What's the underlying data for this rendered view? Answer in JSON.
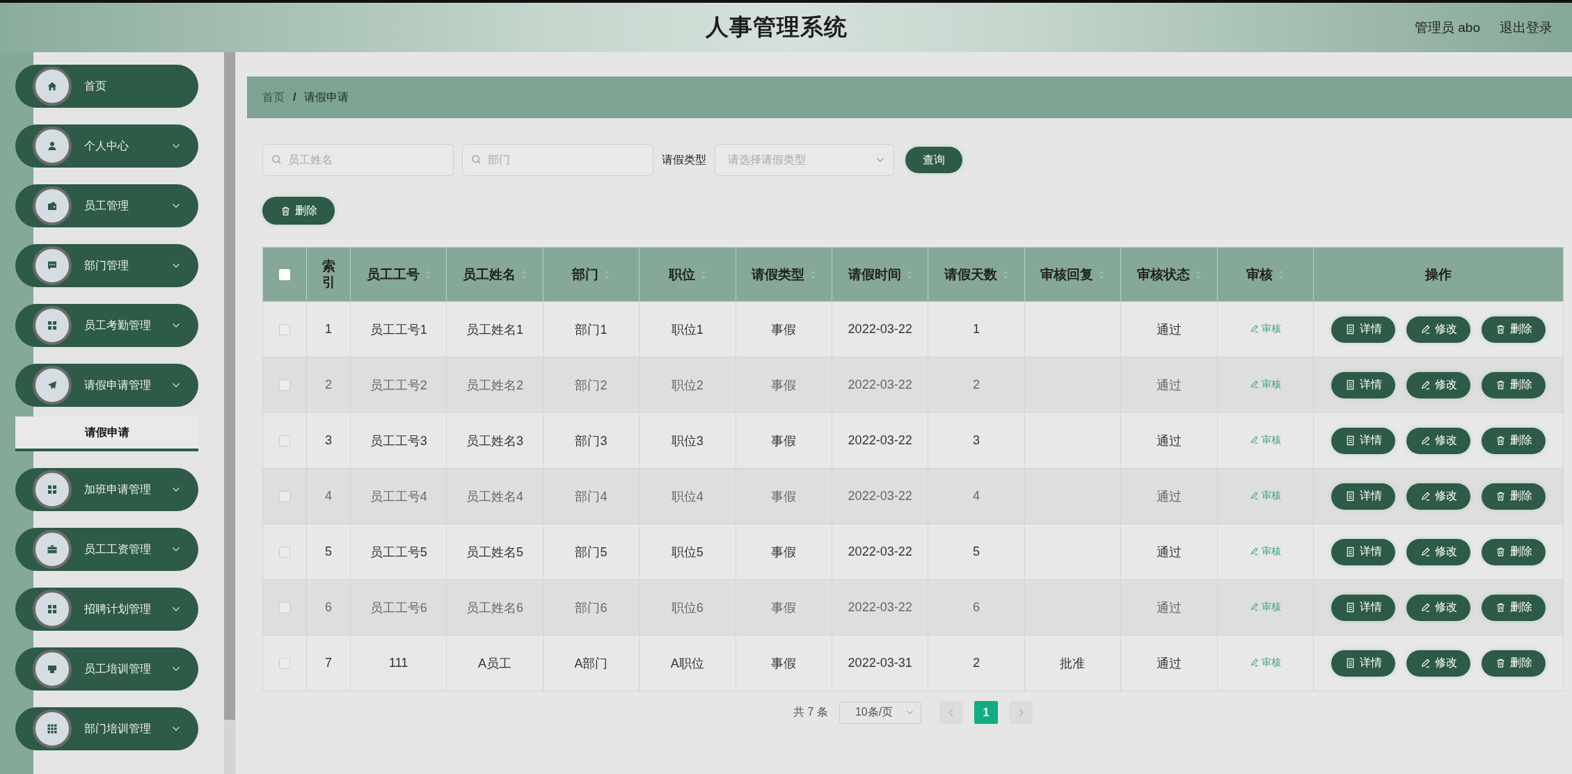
{
  "header": {
    "title": "人事管理系统",
    "user": "管理员 abo",
    "logout": "退出登录"
  },
  "sidebar": {
    "items": [
      {
        "label": "首页",
        "expandable": false
      },
      {
        "label": "个人中心",
        "expandable": true,
        "expanded": false
      },
      {
        "label": "员工管理",
        "expandable": true,
        "expanded": false
      },
      {
        "label": "部门管理",
        "expandable": true,
        "expanded": false
      },
      {
        "label": "员工考勤管理",
        "expandable": true,
        "expanded": false
      },
      {
        "label": "请假申请管理",
        "expandable": true,
        "expanded": true,
        "children": [
          {
            "label": "请假申请",
            "selected": true
          }
        ]
      },
      {
        "label": "加班申请管理",
        "expandable": true,
        "expanded": false
      },
      {
        "label": "员工工资管理",
        "expandable": true,
        "expanded": false
      },
      {
        "label": "招聘计划管理",
        "expandable": true,
        "expanded": false
      },
      {
        "label": "员工培训管理",
        "expandable": true,
        "expanded": false
      },
      {
        "label": "部门培训管理",
        "expandable": true,
        "expanded": false
      }
    ]
  },
  "breadcrumb": {
    "separator": "/",
    "items": [
      "首页",
      "请假申请"
    ]
  },
  "filters": {
    "name_placeholder": "员工姓名",
    "dept_placeholder": "部门",
    "type_label": "请假类型",
    "type_placeholder": "请选择请假类型",
    "search_button": "查询"
  },
  "delete_button": "删除",
  "table": {
    "all_checked": false,
    "columns": [
      {
        "label": "索引",
        "sortable": false
      },
      {
        "label": "员工工号",
        "sortable": true
      },
      {
        "label": "员工姓名",
        "sortable": true
      },
      {
        "label": "部门",
        "sortable": true
      },
      {
        "label": "职位",
        "sortable": true
      },
      {
        "label": "请假类型",
        "sortable": true
      },
      {
        "label": "请假时间",
        "sortable": true
      },
      {
        "label": "请假天数",
        "sortable": true
      },
      {
        "label": "审核回复",
        "sortable": true
      },
      {
        "label": "审核状态",
        "sortable": true
      },
      {
        "label": "审核",
        "sortable": true
      },
      {
        "label": "操作",
        "sortable": false
      }
    ],
    "rows": [
      {
        "checked": false,
        "cells": [
          "1",
          "员工工号1",
          "员工姓名1",
          "部门1",
          "职位1",
          "事假",
          "2022-03-22",
          "1",
          null,
          "通过"
        ],
        "audit": "审核",
        "actions": [
          "详情",
          "修改",
          "删除"
        ]
      },
      {
        "checked": false,
        "cells": [
          "2",
          "员工工号2",
          "员工姓名2",
          "部门2",
          "职位2",
          "事假",
          "2022-03-22",
          "2",
          null,
          "通过"
        ],
        "audit": "审核",
        "actions": [
          "详情",
          "修改",
          "删除"
        ]
      },
      {
        "checked": false,
        "cells": [
          "3",
          "员工工号3",
          "员工姓名3",
          "部门3",
          "职位3",
          "事假",
          "2022-03-22",
          "3",
          null,
          "通过"
        ],
        "audit": "审核",
        "actions": [
          "详情",
          "修改",
          "删除"
        ]
      },
      {
        "checked": false,
        "cells": [
          "4",
          "员工工号4",
          "员工姓名4",
          "部门4",
          "职位4",
          "事假",
          "2022-03-22",
          "4",
          null,
          "通过"
        ],
        "audit": "审核",
        "actions": [
          "详情",
          "修改",
          "删除"
        ]
      },
      {
        "checked": false,
        "cells": [
          "5",
          "员工工号5",
          "员工姓名5",
          "部门5",
          "职位5",
          "事假",
          "2022-03-22",
          "5",
          null,
          "通过"
        ],
        "audit": "审核",
        "actions": [
          "详情",
          "修改",
          "删除"
        ]
      },
      {
        "checked": false,
        "cells": [
          "6",
          "员工工号6",
          "员工姓名6",
          "部门6",
          "职位6",
          "事假",
          "2022-03-22",
          "6",
          null,
          "通过"
        ],
        "audit": "审核",
        "actions": [
          "详情",
          "修改",
          "删除"
        ]
      },
      {
        "checked": false,
        "cells": [
          "7",
          "111",
          "A员工",
          "A部门",
          "A职位",
          "事假",
          "2022-03-31",
          "2",
          "批准",
          "通过"
        ],
        "audit": "审核",
        "actions": [
          "详情",
          "修改",
          "删除"
        ]
      }
    ]
  },
  "pagination": {
    "total": "共 7 条",
    "page_size": "10条/页",
    "pages": [
      {
        "label": "1",
        "selected": true
      }
    ]
  }
}
